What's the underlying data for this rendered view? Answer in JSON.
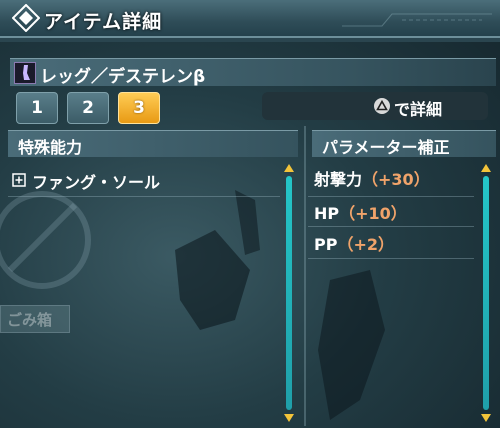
{
  "window": {
    "title": "アイテム詳細"
  },
  "item": {
    "name": "レッグ／デステレンβ"
  },
  "tabs": [
    {
      "label": "1"
    },
    {
      "label": "2"
    },
    {
      "label": "3"
    }
  ],
  "active_tab": 2,
  "detail_button": {
    "label": "で詳細",
    "icon": "triangle-button-icon"
  },
  "abilities": {
    "header": "特殊能力",
    "items": [
      {
        "label": "ファング・ソール"
      }
    ]
  },
  "params": {
    "header": "パラメーター補正",
    "items": [
      {
        "name": "射撃力",
        "bonus": "（+30）"
      },
      {
        "name": "HP",
        "bonus": "（+10）"
      },
      {
        "name": "PP",
        "bonus": "（+2）"
      }
    ]
  },
  "background": {
    "trash_label": "ごみ箱"
  },
  "colors": {
    "accent": "#f0a36a",
    "active_tab": "#f5b53a",
    "scroll": "#22b8bd"
  }
}
